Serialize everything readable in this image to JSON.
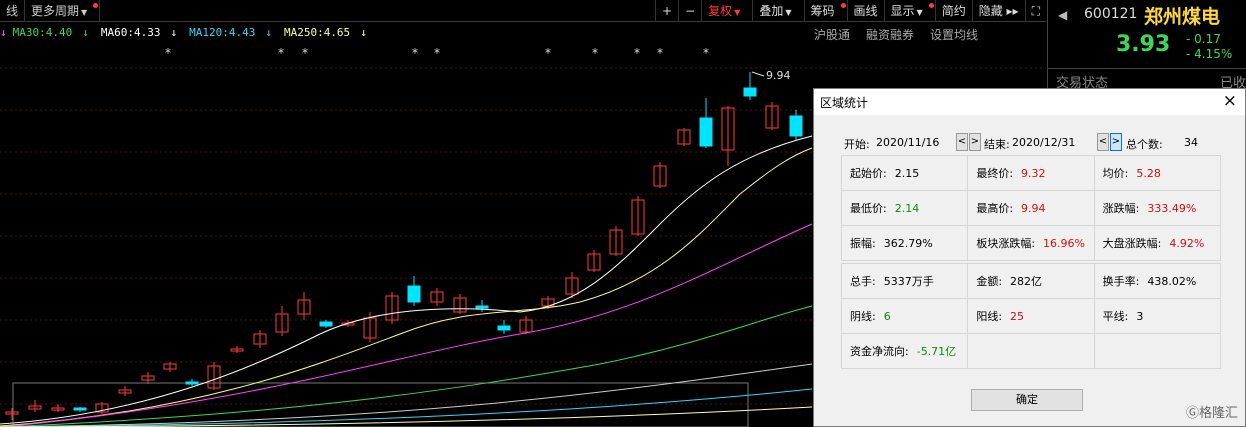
{
  "toolbar": {
    "left_items": [
      "线",
      "更多周期"
    ],
    "right_buttons": [
      {
        "label": "+",
        "active": false,
        "dot": false,
        "caret": false
      },
      {
        "label": "−",
        "active": false,
        "dot": false,
        "caret": false
      },
      {
        "label": "复权",
        "active": true,
        "dot": false,
        "caret": true
      },
      {
        "label": "叠加",
        "active": false,
        "dot": false,
        "caret": true
      },
      {
        "label": "筹码",
        "active": false,
        "dot": true,
        "caret": false
      },
      {
        "label": "画线",
        "active": false,
        "dot": false,
        "caret": false
      },
      {
        "label": "显示",
        "active": false,
        "dot": true,
        "caret": true
      },
      {
        "label": "简约",
        "active": false,
        "dot": false,
        "caret": false
      },
      {
        "label": "隐藏 ▸▸",
        "active": false,
        "dot": false,
        "caret": false
      },
      {
        "label": "⛶",
        "active": false,
        "dot": false,
        "caret": false
      }
    ]
  },
  "ma_legend": [
    {
      "text": "MA30:4.40",
      "arrow": "↓",
      "color": "#3bd85a"
    },
    {
      "text": "MA60:4.33",
      "arrow": "↓",
      "color": "#ffffff"
    },
    {
      "text": "MA120:4.43",
      "arrow": "↓",
      "color": "#33d6ff"
    },
    {
      "text": "MA250:4.65",
      "arrow": "↓",
      "color": "#ffffa0"
    }
  ],
  "ma_legend_prefix_arrow": "↓",
  "sub_tabs": [
    "沪股通",
    "融资融券",
    "设置均线"
  ],
  "chart": {
    "peak_label": "9.94",
    "up_color": "#ff3b3b",
    "down_color": "#00e5ff"
  },
  "quote": {
    "code": "600121",
    "name": "郑州煤电",
    "price": "3.93",
    "change": "- 0.17",
    "change_pct": "- 4.15%",
    "status_label": "交易状态",
    "status_right": "已收"
  },
  "dialog": {
    "title": "区域统计",
    "start_label": "开始:",
    "start_date": "2020/11/16",
    "end_label": "结束:",
    "end_date": "2020/12/31",
    "count_label": "总个数:",
    "count": "34",
    "rows": [
      [
        {
          "label": "起始价:",
          "value": "2.15",
          "color": "black"
        },
        {
          "label": "最终价:",
          "value": "9.32",
          "color": "red"
        },
        {
          "label": "均价:",
          "value": "5.28",
          "color": "red"
        }
      ],
      [
        {
          "label": "最低价:",
          "value": "2.14",
          "color": "green"
        },
        {
          "label": "最高价:",
          "value": "9.94",
          "color": "red"
        },
        {
          "label": "涨跌幅:",
          "value": "333.49%",
          "color": "red"
        }
      ],
      [
        {
          "label": "振幅:",
          "value": "362.79%",
          "color": "black"
        },
        {
          "label": "板块涨跌幅:",
          "value": "16.96%",
          "color": "red"
        },
        {
          "label": "大盘涨跌幅:",
          "value": "4.92%",
          "color": "red"
        }
      ],
      [
        {
          "label": "总手:",
          "value": "5337万手",
          "color": "black"
        },
        {
          "label": "金额:",
          "value": "282亿",
          "color": "black"
        },
        {
          "label": "换手率:",
          "value": "438.02%",
          "color": "black"
        }
      ],
      [
        {
          "label": "阴线:",
          "value": "6",
          "color": "green"
        },
        {
          "label": "阳线:",
          "value": "25",
          "color": "red"
        },
        {
          "label": "平线:",
          "value": "3",
          "color": "black"
        }
      ],
      [
        {
          "label": "资金净流向:",
          "value": "-5.71亿",
          "color": "green"
        },
        {
          "label": "",
          "value": "",
          "color": "black"
        },
        {
          "label": "",
          "value": "",
          "color": "black"
        }
      ]
    ],
    "ok_label": "确定",
    "close_icon": "×"
  },
  "watermark": "Ⓖ格隆汇"
}
